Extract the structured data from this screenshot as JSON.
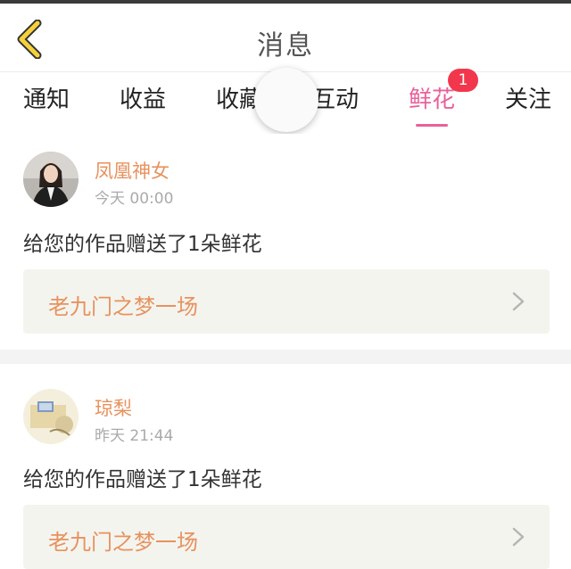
{
  "header": {
    "title": "消息"
  },
  "tabs": [
    {
      "label": "通知",
      "badge": ""
    },
    {
      "label": "收益",
      "badge": ""
    },
    {
      "label": "收藏",
      "badge": ""
    },
    {
      "label": "互动",
      "badge": ""
    },
    {
      "label": "鲜花",
      "badge": "1",
      "active": true
    },
    {
      "label": "关注",
      "badge": ""
    }
  ],
  "messages": [
    {
      "user": "凤凰神女",
      "time": "今天 00:00",
      "text": "给您的作品赠送了1朵鲜花",
      "work": "老九门之梦一场"
    },
    {
      "user": "琼梨",
      "time": "昨天 21:44",
      "text": "给您的作品赠送了1朵鲜花",
      "work": "老九门之梦一场"
    }
  ],
  "colors": {
    "accent": "#e9609b",
    "badge": "#f2374d",
    "name": "#e7925e"
  }
}
